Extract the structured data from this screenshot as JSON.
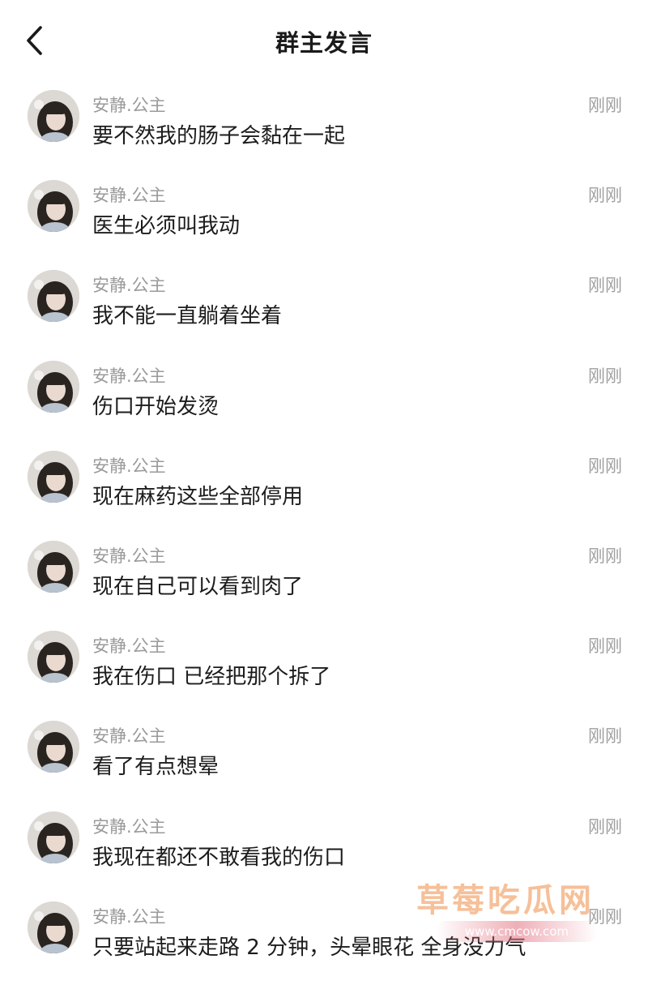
{
  "header": {
    "title": "群主发言",
    "back_icon": "chevron-left-icon"
  },
  "messages": [
    {
      "name": "安静.公主",
      "time": "刚刚",
      "text": "要不然我的肠子会黏在一起"
    },
    {
      "name": "安静.公主",
      "time": "刚刚",
      "text": "医生必须叫我动"
    },
    {
      "name": "安静.公主",
      "time": "刚刚",
      "text": "我不能一直躺着坐着"
    },
    {
      "name": "安静.公主",
      "time": "刚刚",
      "text": "伤口开始发烫"
    },
    {
      "name": "安静.公主",
      "time": "刚刚",
      "text": "现在麻药这些全部停用"
    },
    {
      "name": "安静.公主",
      "time": "刚刚",
      "text": "现在自己可以看到肉了"
    },
    {
      "name": "安静.公主",
      "time": "刚刚",
      "text": "我在伤口 已经把那个拆了"
    },
    {
      "name": "安静.公主",
      "time": "刚刚",
      "text": "看了有点想晕"
    },
    {
      "name": "安静.公主",
      "time": "刚刚",
      "text": "我现在都还不敢看我的伤口"
    },
    {
      "name": "安静.公主",
      "time": "刚刚",
      "text": "只要站起来走路 2 分钟，头晕眼花 全身没力气"
    }
  ],
  "watermark": {
    "main": "草莓吃瓜网",
    "sub": "www.cmcow.com"
  },
  "colors": {
    "name_gray": "#9a9a9a",
    "text_dark": "#1c1c1c",
    "watermark_orange": "#ee8c46"
  }
}
